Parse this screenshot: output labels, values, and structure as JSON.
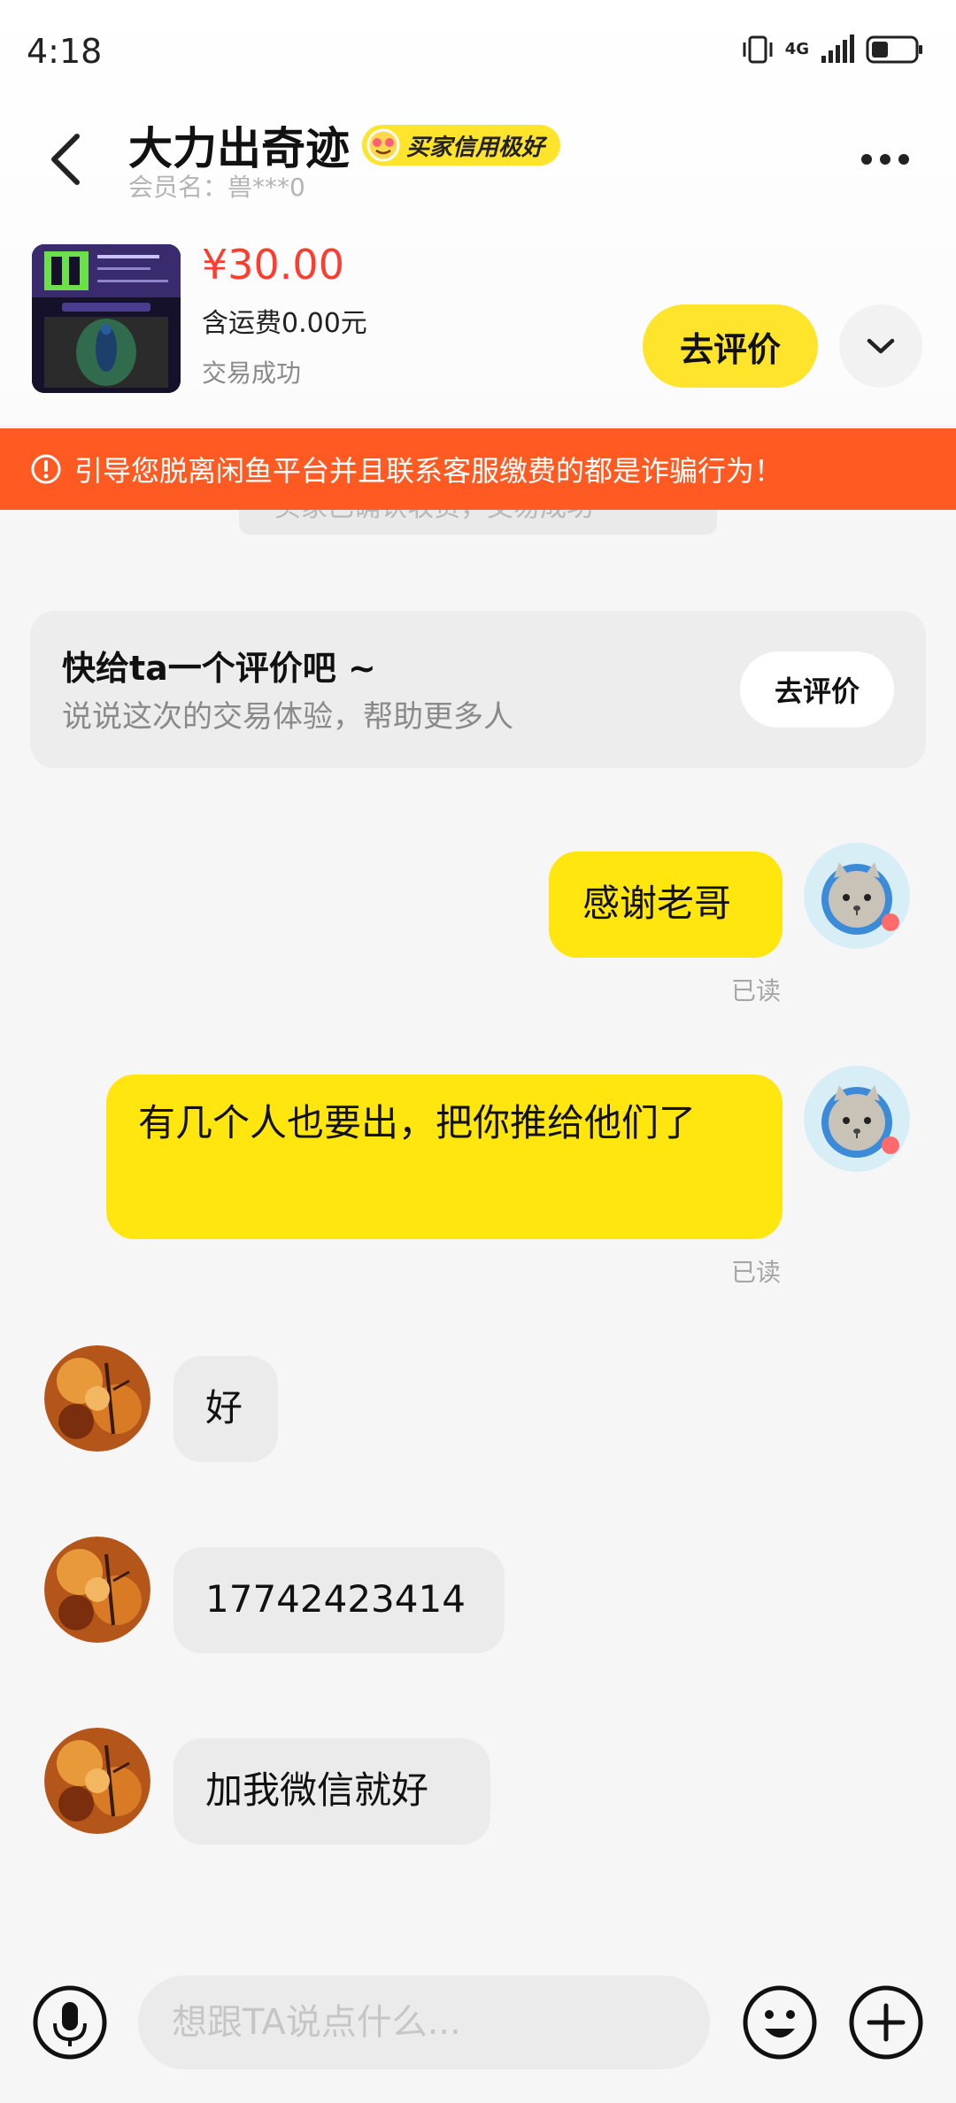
{
  "status_bar": {
    "time": "4:18",
    "network": "4G"
  },
  "header": {
    "title": "大力出奇迹",
    "badge": "买家信用极好",
    "member": "会员名：兽***0"
  },
  "product": {
    "price": "¥30.00",
    "shipping": "含运费0.00元",
    "status": "交易成功",
    "review_button": "去评价"
  },
  "warning": {
    "text": "引导您脱离闲鱼平台并且联系客服缴费的都是诈骗行为！"
  },
  "system_message": {
    "text": "买家已确认收货，交易成功"
  },
  "review_card": {
    "title": "快给ta一个评价吧 ~",
    "subtitle": "说说这次的交易体验，帮助更多人",
    "button": "去评价"
  },
  "messages": [
    {
      "side": "out",
      "text": "感谢老哥",
      "read": "已读"
    },
    {
      "side": "out",
      "text": "有几个人也要出，把你推给他们了",
      "read": "已读"
    },
    {
      "side": "in",
      "text": "好"
    },
    {
      "side": "in",
      "text": "17742423414"
    },
    {
      "side": "in",
      "text": "加我微信就好"
    }
  ],
  "input": {
    "placeholder": "想跟TA说点什么..."
  },
  "colors": {
    "accent": "#ffe42c",
    "warning": "#ff5a22",
    "price": "#ff3c2e"
  }
}
